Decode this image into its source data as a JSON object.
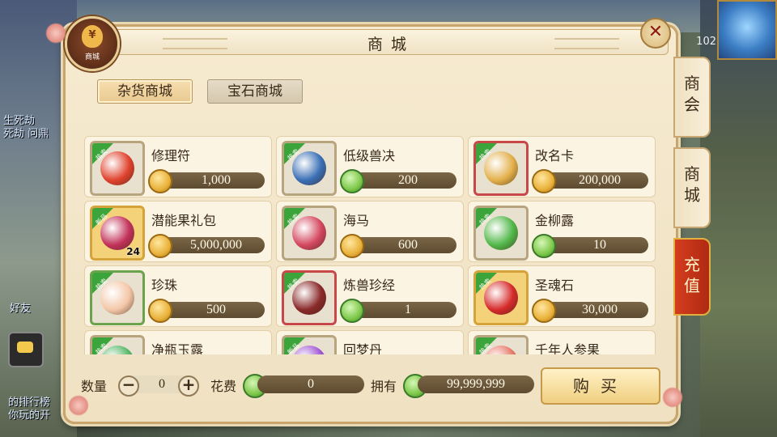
{
  "title": "商城",
  "badge_label": "商城",
  "badge_symbol": "¥",
  "close_symbol": "✕",
  "side_tabs": [
    {
      "label": "商会"
    },
    {
      "label": "商城"
    },
    {
      "label": "充值"
    }
  ],
  "category_tabs": [
    {
      "label": "杂货商城",
      "active": true
    },
    {
      "label": "宝石商城",
      "active": false
    }
  ],
  "items": [
    {
      "name": "修理符",
      "price": "1,000",
      "currency": "coin",
      "ribbon": "热卖",
      "frame": "plain",
      "color": "#e0432e"
    },
    {
      "name": "低级兽决",
      "price": "200",
      "currency": "jade",
      "ribbon": "热卖",
      "frame": "plain",
      "color": "#3a6fb5"
    },
    {
      "name": "改名卡",
      "price": "200,000",
      "currency": "coin",
      "ribbon": "热卖",
      "frame": "red",
      "color": "#e3b04b"
    },
    {
      "name": "潜能果礼包",
      "price": "5,000,000",
      "currency": "coin",
      "ribbon": "新品",
      "frame": "gold",
      "color": "#c3325b",
      "qty": "24"
    },
    {
      "name": "海马",
      "price": "600",
      "currency": "coin",
      "ribbon": "热卖",
      "frame": "plain",
      "color": "#d4485f"
    },
    {
      "name": "金柳露",
      "price": "10",
      "currency": "jade",
      "ribbon": "热卖",
      "frame": "plain",
      "color": "#52b84a"
    },
    {
      "name": "珍珠",
      "price": "500",
      "currency": "coin",
      "ribbon": "热卖",
      "frame": "green",
      "color": "#f4c7a8"
    },
    {
      "name": "炼兽珍经",
      "price": "1",
      "currency": "jade",
      "ribbon": "热卖",
      "frame": "red",
      "color": "#8a2a2a"
    },
    {
      "name": "圣魂石",
      "price": "30,000",
      "currency": "coin",
      "ribbon": "热卖",
      "frame": "gold",
      "color": "#d62b2b"
    },
    {
      "name": "净瓶玉露",
      "price": "",
      "currency": "jade",
      "ribbon": "热卖",
      "frame": "plain",
      "color": "#58b86a"
    },
    {
      "name": "回梦丹",
      "price": "",
      "currency": "jade",
      "ribbon": "新品",
      "frame": "plain",
      "color": "#a259d6"
    },
    {
      "name": "千年人参果",
      "price": "",
      "currency": "coin",
      "ribbon": "热卖",
      "frame": "plain",
      "color": "#e87b6a"
    }
  ],
  "bottom": {
    "quantity_label": "数量",
    "quantity_value": "0",
    "minus": "−",
    "plus": "+",
    "cost_label": "花费",
    "cost_value": "0",
    "own_label": "拥有",
    "own_value": "99,999,999",
    "buy_label": "购买"
  },
  "background": {
    "level": "102",
    "chat_lines": [
      "生死劫",
      "死劫 问鼎",
      "好友",
      "的排行榜",
      "你玩的开"
    ]
  }
}
